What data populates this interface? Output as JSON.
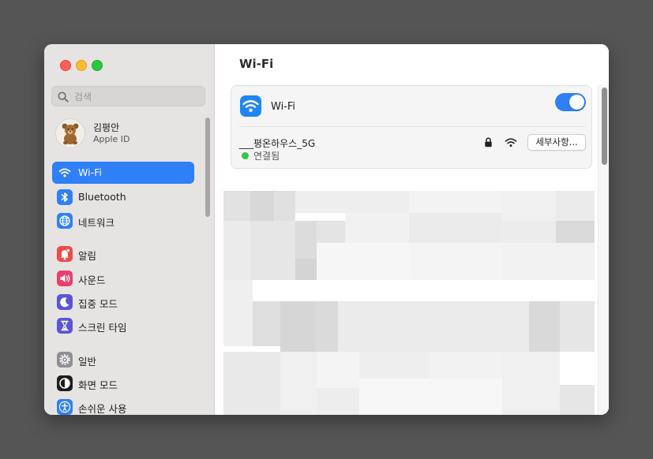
{
  "window": {
    "traffic_lights": [
      "close",
      "minimize",
      "maximize"
    ]
  },
  "sidebar": {
    "search": {
      "placeholder": "검색",
      "value": "",
      "icon": "search-icon"
    },
    "account": {
      "name": "김평안",
      "subtitle": "Apple ID",
      "avatar": "teddy-bear"
    },
    "items": [
      {
        "label": "Wi-Fi",
        "icon": "wifi-icon",
        "icon_color": "#2f7ff7",
        "selected": true
      },
      {
        "label": "Bluetooth",
        "icon": "bluetooth-icon",
        "icon_color": "#2f7ff7"
      },
      {
        "label": "네트워크",
        "icon": "globe-icon",
        "icon_color": "#2f7ff7"
      },
      {
        "label": "알림",
        "icon": "bell-icon",
        "icon_color": "#f04a45"
      },
      {
        "label": "사운드",
        "icon": "speaker-icon",
        "icon_color": "#ea3f6d"
      },
      {
        "label": "집중 모드",
        "icon": "moon-icon",
        "icon_color": "#5b54d6"
      },
      {
        "label": "스크린 타임",
        "icon": "hourglass-icon",
        "icon_color": "#5b54d6"
      },
      {
        "label": "일반",
        "icon": "gear-icon",
        "icon_color": "#8e8e93"
      },
      {
        "label": "화면 모드",
        "icon": "appearance-icon",
        "icon_color": "#1d1d1d"
      },
      {
        "label": "손쉬운 사용",
        "icon": "accessibility-icon",
        "icon_color": "#2f7ff7"
      }
    ]
  },
  "content": {
    "title": "Wi-Fi",
    "wifi_row": {
      "label": "Wi-Fi",
      "toggle_on": true
    },
    "network": {
      "ssid": "___평온하우스_5G",
      "status": "연결됨",
      "status_color": "#31c748",
      "details_button": "세부사항..."
    }
  },
  "colors": {
    "accent": "#2f7ff7",
    "arrow": "#f25022"
  }
}
